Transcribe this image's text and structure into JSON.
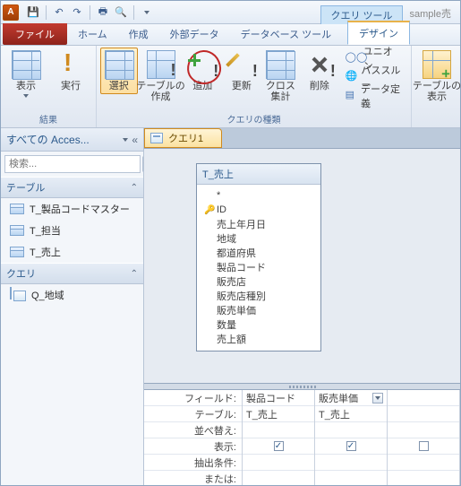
{
  "qat": {
    "app": "A"
  },
  "context": {
    "title": "クエリ ツール",
    "extra": "sample売"
  },
  "tabs": {
    "file": "ファイル",
    "home": "ホーム",
    "create": "作成",
    "ext": "外部データ",
    "db": "データベース ツール",
    "design": "デザイン"
  },
  "ribbon": {
    "results": {
      "label": "結果",
      "view": "表示",
      "run": "実行"
    },
    "qtype": {
      "label": "クエリの種類",
      "select": "選択",
      "maketable": "テーブルの\n作成",
      "append": "追加",
      "update": "更新",
      "crosstab": "クロス\n集計",
      "delete": "削除",
      "union": "ユニオン",
      "passthru": "パススルー",
      "datadef": "データ定義"
    },
    "showtbl": {
      "label": "テーブルの\n表示"
    }
  },
  "nav": {
    "header": "すべての Acces...",
    "search_ph": "検索...",
    "sect_tables": "テーブル",
    "sect_queries": "クエリ",
    "tables": [
      "T_製品コードマスター",
      "T_担当",
      "T_売上"
    ],
    "queries": [
      "Q_地域"
    ]
  },
  "obj": {
    "tab": "クエリ1"
  },
  "fieldlist": {
    "title": "T_売上",
    "star": "*",
    "key": "ID",
    "fields": [
      "売上年月日",
      "地域",
      "都道府県",
      "製品コード",
      "販売店",
      "販売店種別",
      "販売単価",
      "数量",
      "売上額"
    ]
  },
  "qbe": {
    "labels": {
      "field": "フィールド:",
      "table": "テーブル:",
      "sort": "並べ替え:",
      "show": "表示:",
      "criteria": "抽出条件:",
      "or": "または:"
    },
    "cols": [
      {
        "field": "製品コード",
        "table": "T_売上",
        "show": true
      },
      {
        "field": "販売単価",
        "table": "T_売上",
        "show": true,
        "combo": true
      },
      {
        "field": "",
        "table": "",
        "show": false
      }
    ]
  }
}
